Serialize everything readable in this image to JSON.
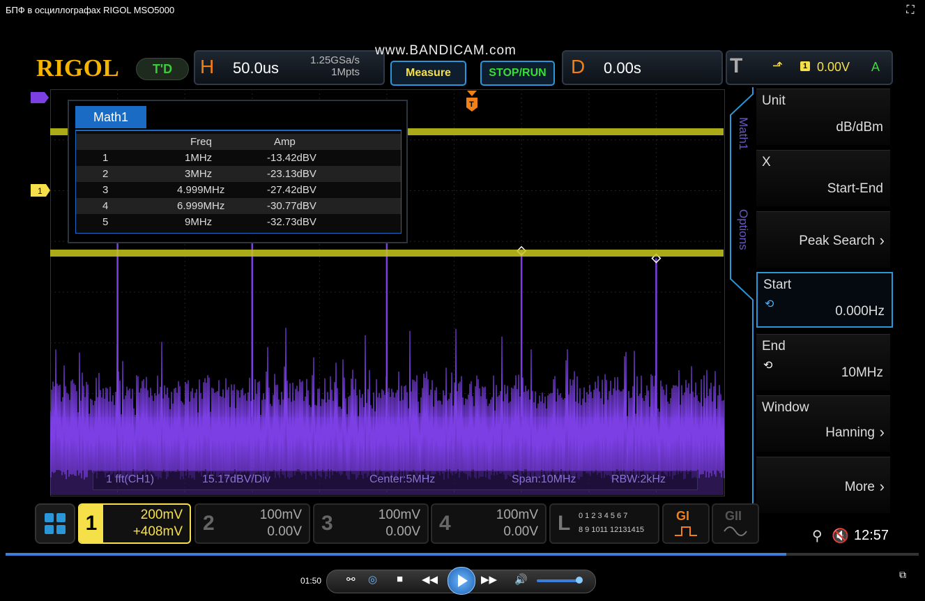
{
  "window": {
    "title": "БПФ в осциллографах RIGOL MSO5000"
  },
  "watermark": "www.BANDICAM.com",
  "top": {
    "logo": "RIGOL",
    "td": "T'D",
    "h_label": "H",
    "timebase": "50.0us",
    "sample_rate": "1.25GSa/s",
    "memory_depth": "1Mpts",
    "measure": "Measure",
    "stop_run": "STOP/RUN",
    "d_label": "D",
    "delay": "0.00s",
    "t_label": "T",
    "trigger_source": "1",
    "trigger_level": "0.00V",
    "trigger_mode": "A"
  },
  "peak_table": {
    "tab": "Math1",
    "headers": [
      "Freq",
      "Amp"
    ],
    "rows": [
      {
        "n": "1",
        "freq": "1MHz",
        "amp": "-13.42dBV"
      },
      {
        "n": "2",
        "freq": "3MHz",
        "amp": "-23.13dBV"
      },
      {
        "n": "3",
        "freq": "4.999MHz",
        "amp": "-27.42dBV"
      },
      {
        "n": "4",
        "freq": "6.999MHz",
        "amp": "-30.77dBV"
      },
      {
        "n": "5",
        "freq": "9MHz",
        "amp": "-32.73dBV"
      }
    ]
  },
  "fft_info": {
    "source": "1  fft(CH1)",
    "scale": "15.17dBV/Div",
    "center": "Center:5MHz",
    "span": "Span:10MHz",
    "rbw": "RBW:2kHz"
  },
  "markers": {
    "ch1": "1",
    "trigger": "T"
  },
  "menu": {
    "tab_math": "Math1",
    "tab_options": "Options",
    "items": [
      {
        "label": "Unit",
        "value": "dB/dBm"
      },
      {
        "label": "X",
        "value": "Start-End"
      },
      {
        "label": "",
        "value": "Peak Search"
      },
      {
        "label": "Start",
        "value": "0.000Hz"
      },
      {
        "label": "End",
        "value": "10MHz"
      },
      {
        "label": "Window",
        "value": "Hanning"
      },
      {
        "label": "",
        "value": "More"
      }
    ]
  },
  "channels": [
    {
      "num": "1",
      "scale": "200mV",
      "offset": "+408mV",
      "color": "#f6e04a"
    },
    {
      "num": "2",
      "scale": "100mV",
      "offset": "0.00V",
      "color": "#666666"
    },
    {
      "num": "3",
      "scale": "100mV",
      "offset": "0.00V",
      "color": "#666666"
    },
    {
      "num": "4",
      "scale": "100mV",
      "offset": "0.00V",
      "color": "#666666"
    }
  ],
  "logic": {
    "label": "L",
    "row1": "0 1 2 3  4 5 6 7",
    "row2": "8 9 1011 12131415"
  },
  "gen": {
    "g1": "GI",
    "g2": "GII"
  },
  "status": {
    "time": "12:57"
  },
  "player": {
    "time": "01:50"
  },
  "colors": {
    "ch1": "#f6e04a",
    "math": "#7b3fe4",
    "accent": "#2a97d8"
  },
  "chart_data": {
    "type": "line",
    "title": "",
    "xlabel": "",
    "ylabel": "",
    "xlim": [
      0,
      10
    ],
    "peaks": [
      {
        "x": 1,
        "y": -13.42
      },
      {
        "x": 3,
        "y": -23.13
      },
      {
        "x": 4.999,
        "y": -27.42
      },
      {
        "x": 6.999,
        "y": -30.77
      },
      {
        "x": 9,
        "y": -32.73
      }
    ]
  }
}
